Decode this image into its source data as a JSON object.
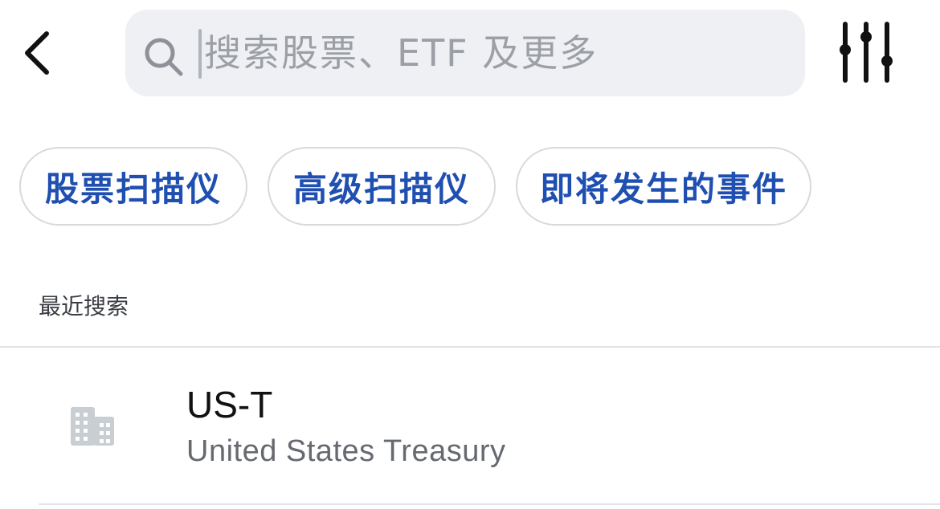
{
  "header": {
    "back_icon": "chevron-left-icon",
    "search": {
      "icon": "search-icon",
      "placeholder": "搜索股票、ETF 及更多",
      "value": ""
    },
    "filter_icon": "sliders-icon"
  },
  "chips": [
    {
      "label": "股票扫描仪"
    },
    {
      "label": "高级扫描仪"
    },
    {
      "label": "即将发生的事件"
    }
  ],
  "recent": {
    "title": "最近搜索",
    "items": [
      {
        "icon": "building-icon",
        "symbol": "US-T",
        "name": "United States Treasury"
      }
    ]
  },
  "colors": {
    "accent": "#1f4fb0",
    "search_bg": "#eff0f3",
    "divider": "#e2e3e6",
    "secondary_text": "#666a70"
  }
}
